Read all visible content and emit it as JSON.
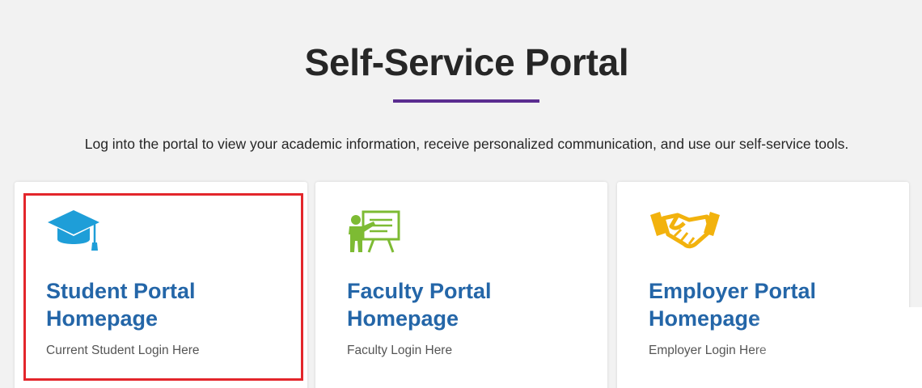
{
  "header": {
    "title": "Self-Service Portal",
    "accent_color": "#5b2d90",
    "intro": "Log into the portal to view your academic information, receive personalized communication, and use our self-service tools."
  },
  "cards": [
    {
      "icon": "graduation-cap-icon",
      "icon_color": "#1e9ed8",
      "title_line1": "Student Portal",
      "title_line2": "Homepage",
      "subtitle": "Current Student Login Here",
      "highlighted": true,
      "highlight_color": "#e3262b"
    },
    {
      "icon": "teacher-presentation-icon",
      "icon_color": "#7dbb33",
      "title_line1": "Faculty Portal",
      "title_line2": "Homepage",
      "subtitle": "Faculty Login Here"
    },
    {
      "icon": "handshake-icon",
      "icon_color": "#f2b20d",
      "title_line1": "Employer Portal",
      "title_line2": "Homepage",
      "subtitle": "Employer Login Here"
    }
  ],
  "theme": {
    "title_color": "#2466a8",
    "background": "#f2f2f2"
  }
}
